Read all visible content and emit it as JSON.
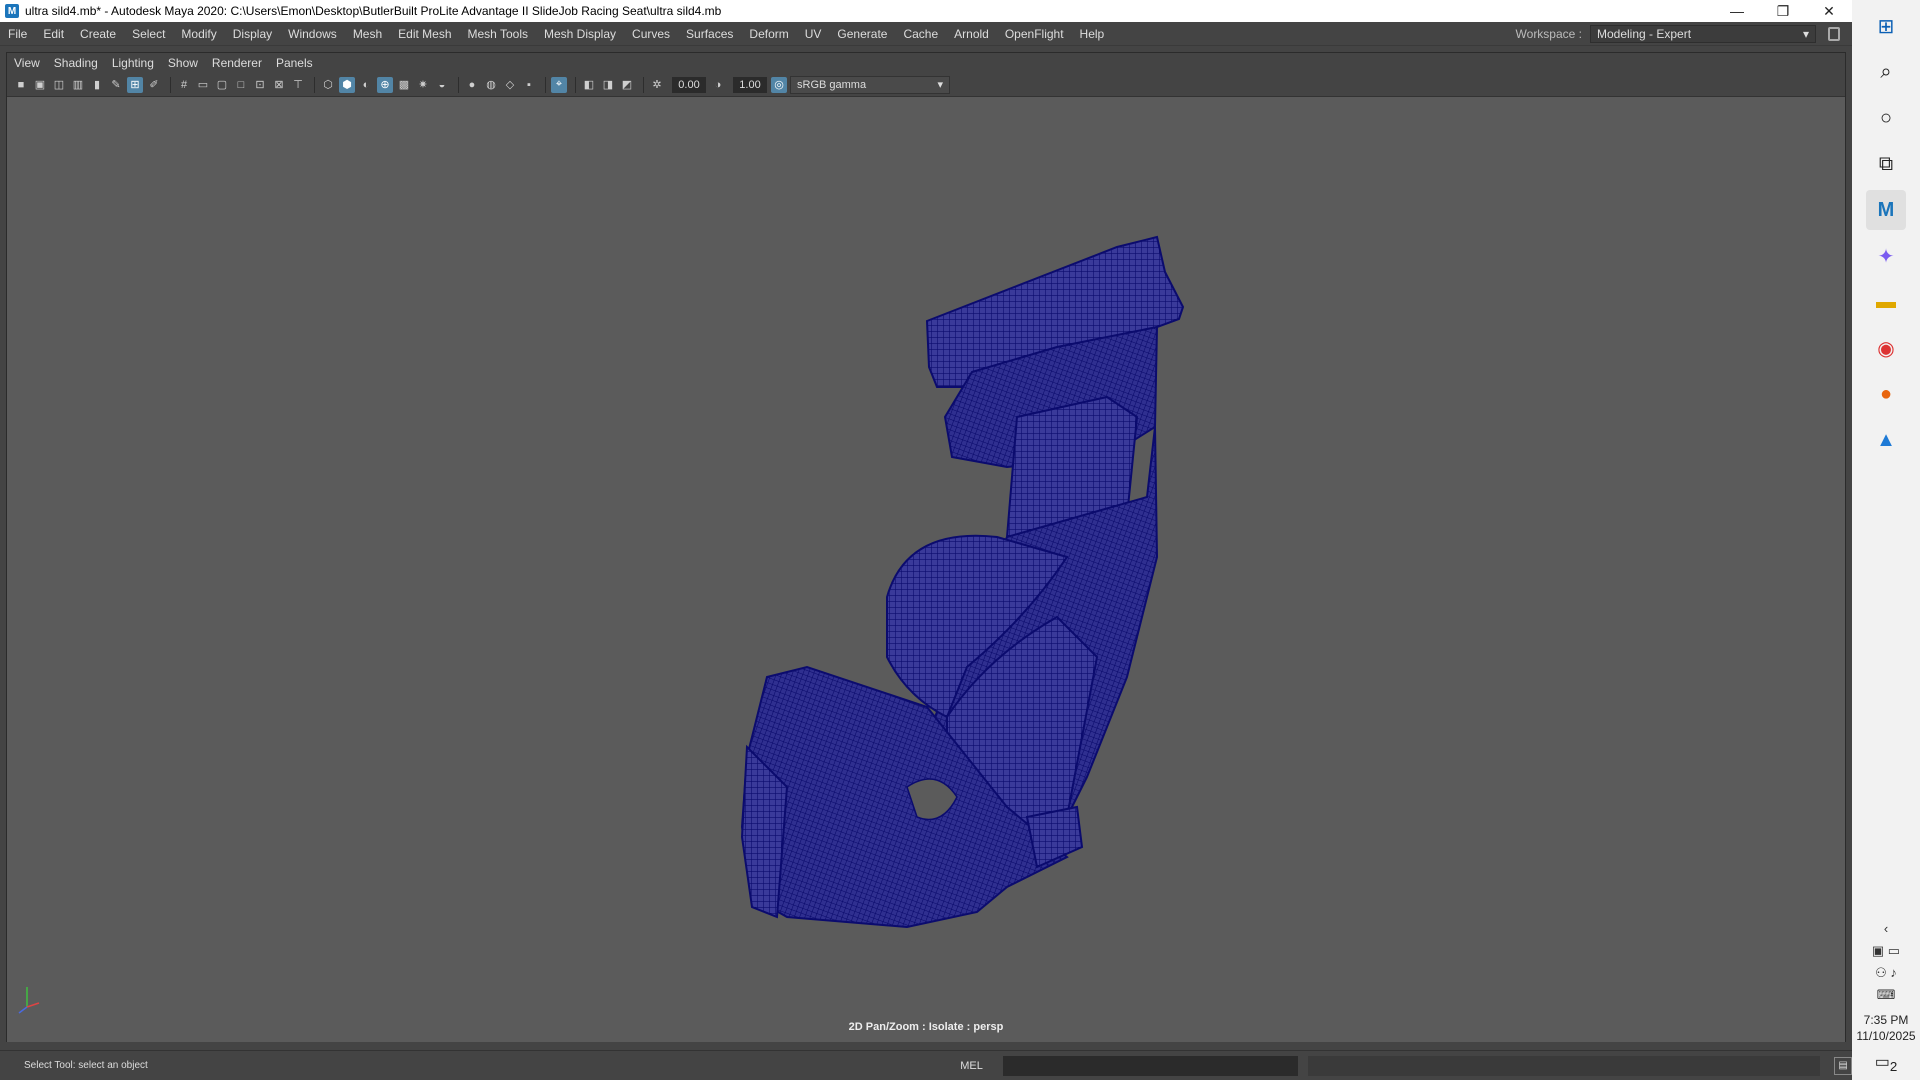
{
  "window": {
    "title": "ultra sild4.mb* - Autodesk Maya 2020: C:\\Users\\Emon\\Desktop\\ButlerBuilt ProLite Advantage II SlideJob Racing Seat\\ultra sild4.mb",
    "app_icon": "M",
    "minimize_glyph": "—",
    "restore_glyph": "❐",
    "close_glyph": "✕"
  },
  "menu": [
    "File",
    "Edit",
    "Create",
    "Select",
    "Modify",
    "Display",
    "Windows",
    "Mesh",
    "Edit Mesh",
    "Mesh Tools",
    "Mesh Display",
    "Curves",
    "Surfaces",
    "Deform",
    "UV",
    "Generate",
    "Cache",
    "Arnold",
    "OpenFlight",
    "Help"
  ],
  "workspace": {
    "label": "Workspace :",
    "value": "Modeling - Expert"
  },
  "panel_menu": [
    "View",
    "Shading",
    "Lighting",
    "Show",
    "Renderer",
    "Panels"
  ],
  "panel_toolbar": {
    "exposure": "0.00",
    "gamma": "1.00",
    "color_space": "sRGB gamma"
  },
  "viewport": {
    "hud": "2D Pan/Zoom : Isolate : persp",
    "wire_color": "#0b0b6e",
    "background": "#5b5b5b"
  },
  "status": {
    "help": "Select Tool: select an object",
    "mel_label": "MEL"
  },
  "taskbar": {
    "time": "7:35 PM",
    "date": "11/10/2025",
    "notifications": "2"
  }
}
